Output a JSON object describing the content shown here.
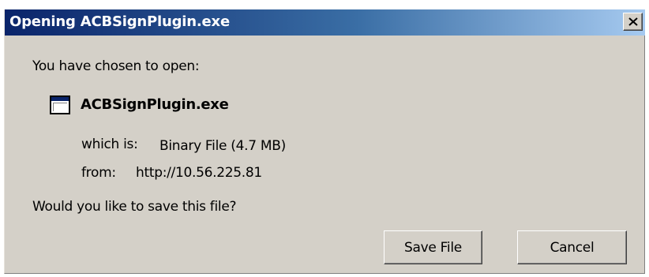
{
  "window": {
    "title": "Opening ACBSignPlugin.exe",
    "close_icon": "close-icon"
  },
  "body": {
    "intro": "You have chosen to open:",
    "file_icon": "application-window-icon",
    "filename": "ACBSignPlugin.exe",
    "type_label": "which is:",
    "type_value": "Binary File (4.7 MB)",
    "from_label": "from:",
    "from_value": "http://10.56.225.81",
    "question": "Would you like to save this file?"
  },
  "buttons": {
    "save_label": "Save File",
    "cancel_label": "Cancel"
  }
}
